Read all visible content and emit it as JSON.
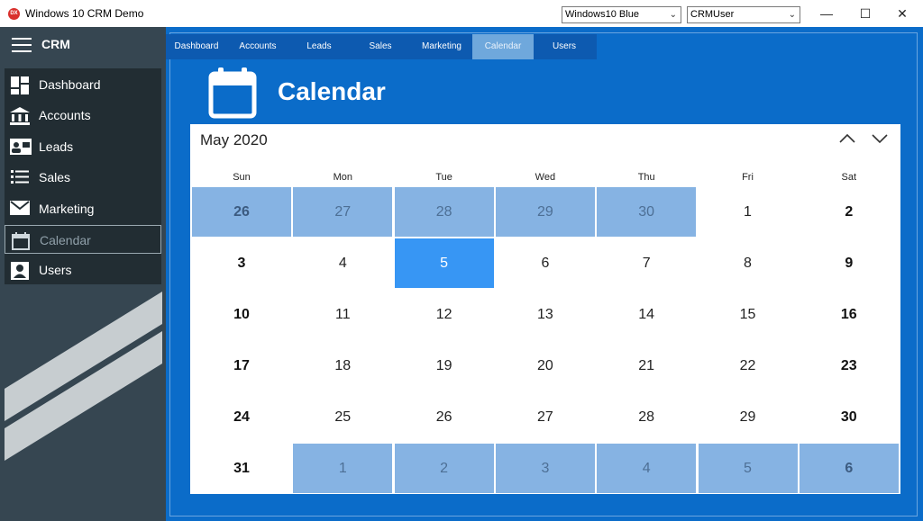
{
  "window": {
    "title": "Windows 10 CRM Demo",
    "app_icon_text": "DX"
  },
  "toolbar": {
    "theme_value": "Windows10 Blue",
    "user_value": "CRMUser"
  },
  "window_controls": {
    "minimize": "—",
    "maximize": "☐",
    "close": "✕"
  },
  "sidebar": {
    "title": "CRM",
    "items": [
      {
        "label": "Dashboard",
        "icon": "dashboard-icon"
      },
      {
        "label": "Accounts",
        "icon": "bank-icon"
      },
      {
        "label": "Leads",
        "icon": "contact-card-icon"
      },
      {
        "label": "Sales",
        "icon": "list-icon"
      },
      {
        "label": "Marketing",
        "icon": "mail-icon"
      },
      {
        "label": "Calendar",
        "icon": "calendar-icon",
        "active": true
      },
      {
        "label": "Users",
        "icon": "user-icon"
      }
    ]
  },
  "tabs": [
    {
      "label": "Dashboard"
    },
    {
      "label": "Accounts"
    },
    {
      "label": "Leads"
    },
    {
      "label": "Sales"
    },
    {
      "label": "Marketing"
    },
    {
      "label": "Calendar",
      "active": true
    },
    {
      "label": "Users"
    }
  ],
  "page": {
    "title": "Calendar"
  },
  "calendar": {
    "month_label": "May 2020",
    "weekdays": [
      "Sun",
      "Mon",
      "Tue",
      "Wed",
      "Thu",
      "Fri",
      "Sat"
    ],
    "weeks": [
      [
        "26",
        "27",
        "28",
        "29",
        "30",
        "1",
        "2"
      ],
      [
        "3",
        "4",
        "5",
        "6",
        "7",
        "8",
        "9"
      ],
      [
        "10",
        "11",
        "12",
        "13",
        "14",
        "15",
        "16"
      ],
      [
        "17",
        "18",
        "19",
        "20",
        "21",
        "22",
        "23"
      ],
      [
        "24",
        "25",
        "26",
        "27",
        "28",
        "29",
        "30"
      ],
      [
        "31",
        "1",
        "2",
        "3",
        "4",
        "5",
        "6"
      ]
    ],
    "other_month_cells": [
      [
        0,
        0
      ],
      [
        0,
        1
      ],
      [
        0,
        2
      ],
      [
        0,
        3
      ],
      [
        0,
        4
      ],
      [
        5,
        1
      ],
      [
        5,
        2
      ],
      [
        5,
        3
      ],
      [
        5,
        4
      ],
      [
        5,
        5
      ],
      [
        5,
        6
      ]
    ],
    "selected_cell": [
      1,
      2
    ]
  },
  "colors": {
    "accent": "#0b6cc9",
    "sidebar": "#364651",
    "selected": "#3796f4",
    "other_month": "#86b3e3"
  }
}
